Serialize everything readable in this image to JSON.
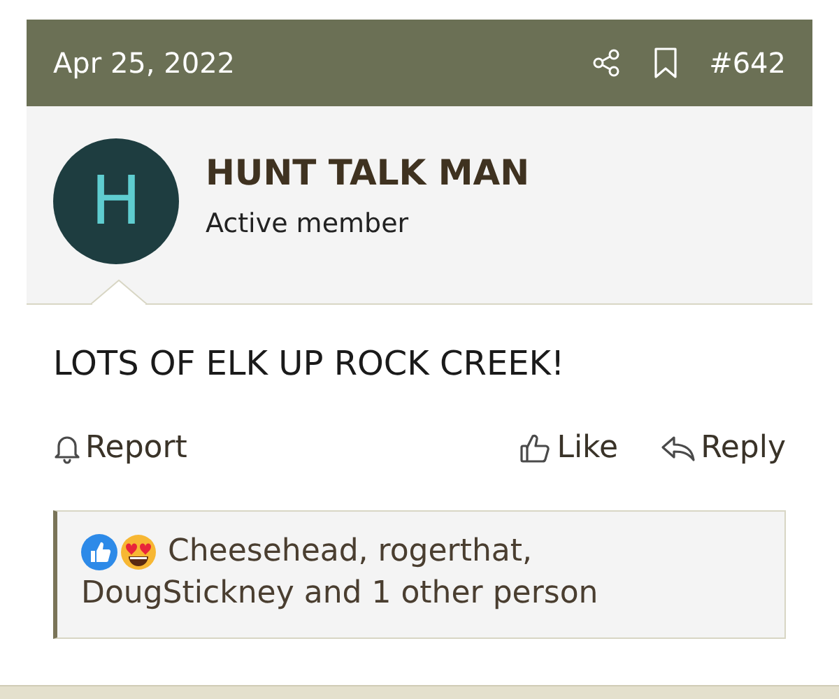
{
  "post": {
    "date": "Apr 25, 2022",
    "number": "#642"
  },
  "author": {
    "initial": "H",
    "name": "HUNT TALK MAN",
    "title": "Active member"
  },
  "message": "LOTS OF ELK UP ROCK CREEK!",
  "actions": [
    {
      "kind": "report",
      "label": "Report"
    },
    {
      "kind": "like",
      "label": "Like"
    },
    {
      "kind": "reply",
      "label": "Reply"
    }
  ],
  "reactions": {
    "text": "Cheesehead, rogerthat, DougStickney and 1 other person"
  }
}
